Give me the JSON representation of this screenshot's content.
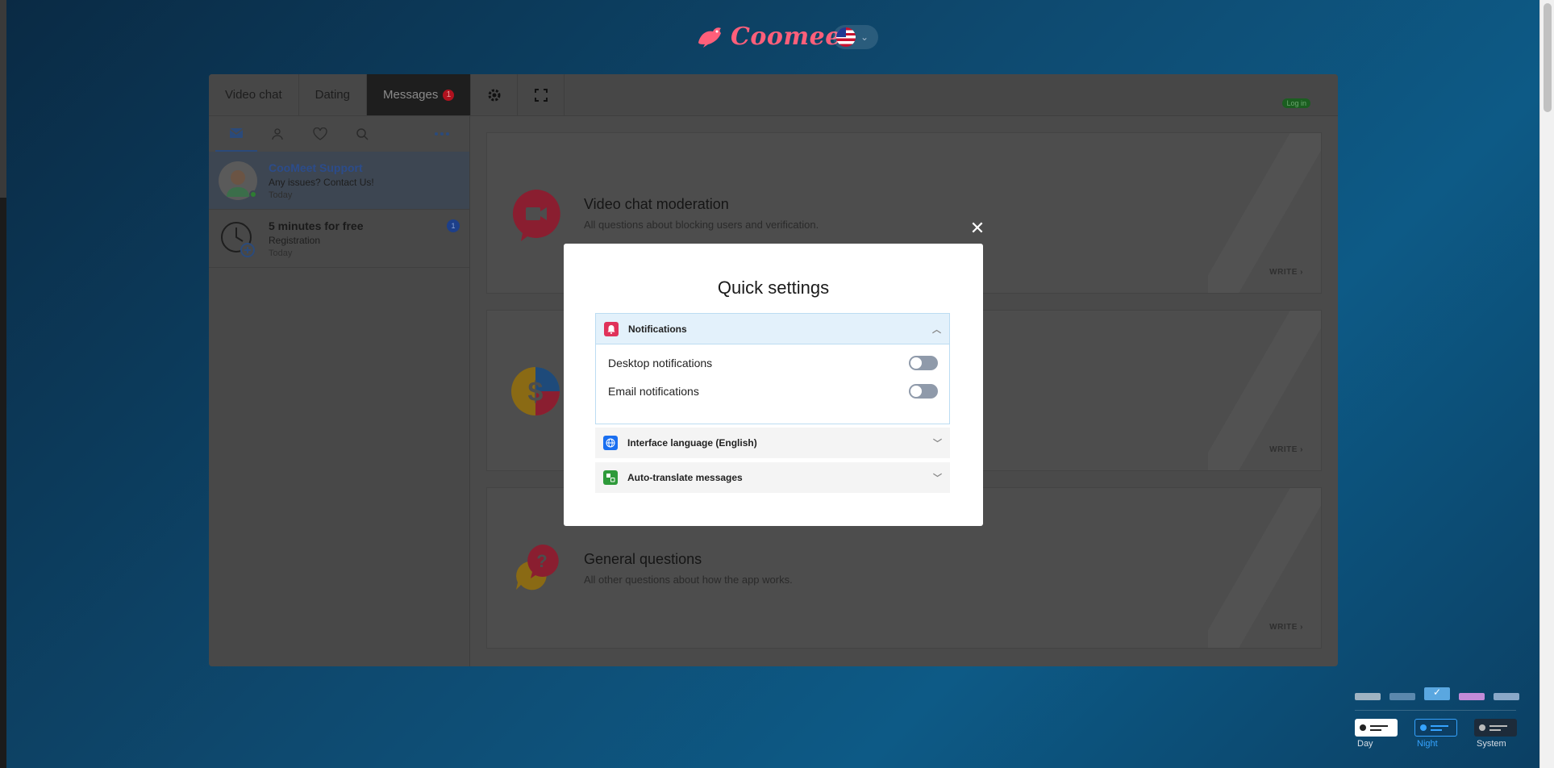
{
  "brand": {
    "name": "Coomeet"
  },
  "language": {
    "flag": "us-flag-icon"
  },
  "tabs": [
    {
      "label": "Video chat"
    },
    {
      "label": "Dating"
    },
    {
      "label": "Messages",
      "badge": "1"
    }
  ],
  "login_label": "Log in",
  "chats": [
    {
      "name": "CooMeet Support",
      "preview": "Any issues? Contact Us!",
      "date": "Today"
    },
    {
      "name": "5 minutes for free",
      "preview": "Registration",
      "date": "Today",
      "count": "1"
    }
  ],
  "cards": [
    {
      "title": "Video chat moderation",
      "desc": "All questions about blocking users and verification.",
      "action": "WRITE"
    },
    {
      "title": "",
      "desc": "",
      "action": "WRITE"
    },
    {
      "title": "General questions",
      "desc": "All other questions about how the app works.",
      "action": "WRITE"
    }
  ],
  "modal": {
    "title": "Quick settings",
    "sections": [
      {
        "label": "Notifications",
        "expanded": true,
        "icon": "bell-icon",
        "color": "#e0325a"
      },
      {
        "label": "Interface language (English)",
        "expanded": false,
        "icon": "globe-icon",
        "color": "#1a6ff0"
      },
      {
        "label": "Auto-translate messages",
        "expanded": false,
        "icon": "translate-icon",
        "color": "#2e9a3a"
      }
    ],
    "options": [
      {
        "label": "Desktop notifications",
        "enabled": false
      },
      {
        "label": "Email notifications",
        "enabled": false
      }
    ]
  },
  "theme": {
    "swatches": [
      "#9fb3c2",
      "#5b88ad",
      "#5aa7e0",
      "#c38bd8",
      "#8aa8c8"
    ],
    "selected_swatch": 2,
    "modes": [
      {
        "label": "Day"
      },
      {
        "label": "Night",
        "selected": true
      },
      {
        "label": "System"
      }
    ]
  }
}
